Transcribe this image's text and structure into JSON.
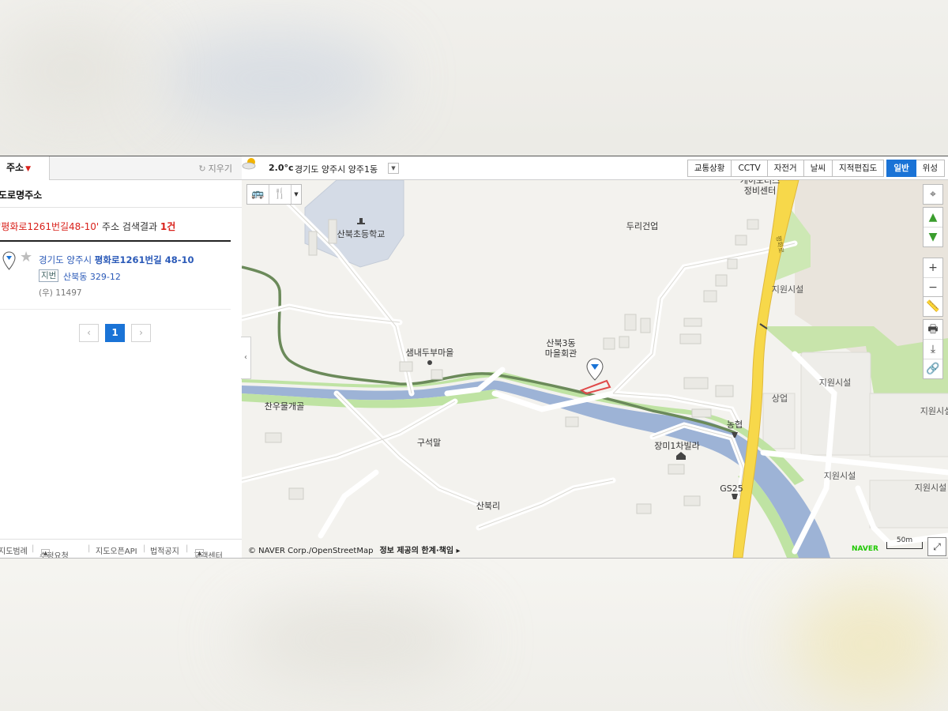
{
  "left_panel": {
    "tab_label": "주소",
    "clear_label": "지우기",
    "road_address_title": "도로명주소",
    "query": "'평화로1261번길48-10'",
    "summary_text": " 주소 검색결과 ",
    "result_count": "1건",
    "result": {
      "addr_prefix": "경기도 양주시 ",
      "addr_road": "평화로1261번길 48-10",
      "jibun_badge": "지번",
      "jibun_value": "산북동 329-12",
      "zip": "(우) 11497"
    },
    "pager": {
      "prev": "‹",
      "current": "1",
      "next": "›"
    },
    "footer": [
      "지도범례",
      "수정요청",
      "지도오픈API",
      "법적공지",
      "고객센터"
    ]
  },
  "map": {
    "weather": {
      "temp": "2.0°c",
      "region": "경기도 양주시 양주1동"
    },
    "modes": [
      "교통상황",
      "CCTV",
      "자전거",
      "날씨",
      "지적편집도"
    ],
    "map_types": [
      "일반",
      "위성"
    ],
    "labels": {
      "school": "산북초등학교",
      "garage": "케이모터스\n정비센터",
      "duri": "두리건업",
      "village1": "샘내두부마을",
      "hall": "산북3동\n마을회관",
      "chan": "찬우물개골",
      "guseok": "구석말",
      "villa": "장미1차빌라",
      "nh": "농협",
      "gs": "GS25",
      "sanbuk": "산북리",
      "sangup": "상업",
      "jiwon1": "지원시설",
      "jiwon2": "지원시설",
      "jiwon3": "지원시설",
      "jiwon4": "지원시설",
      "jiwon5": "지원시설",
      "pyeonghwa": "평화로"
    },
    "copyright": "© NAVER Corp./OpenStreetMap",
    "disclaimer": "정보 제공의 한계·책임 ▸",
    "naver": "NAVER",
    "scale": "50m"
  },
  "colors": {
    "accent": "#1a73d6",
    "highlight": "#d9211b",
    "road_main": "#f7d84a",
    "river": "#9db3d6",
    "green": "#bfe3a3"
  }
}
